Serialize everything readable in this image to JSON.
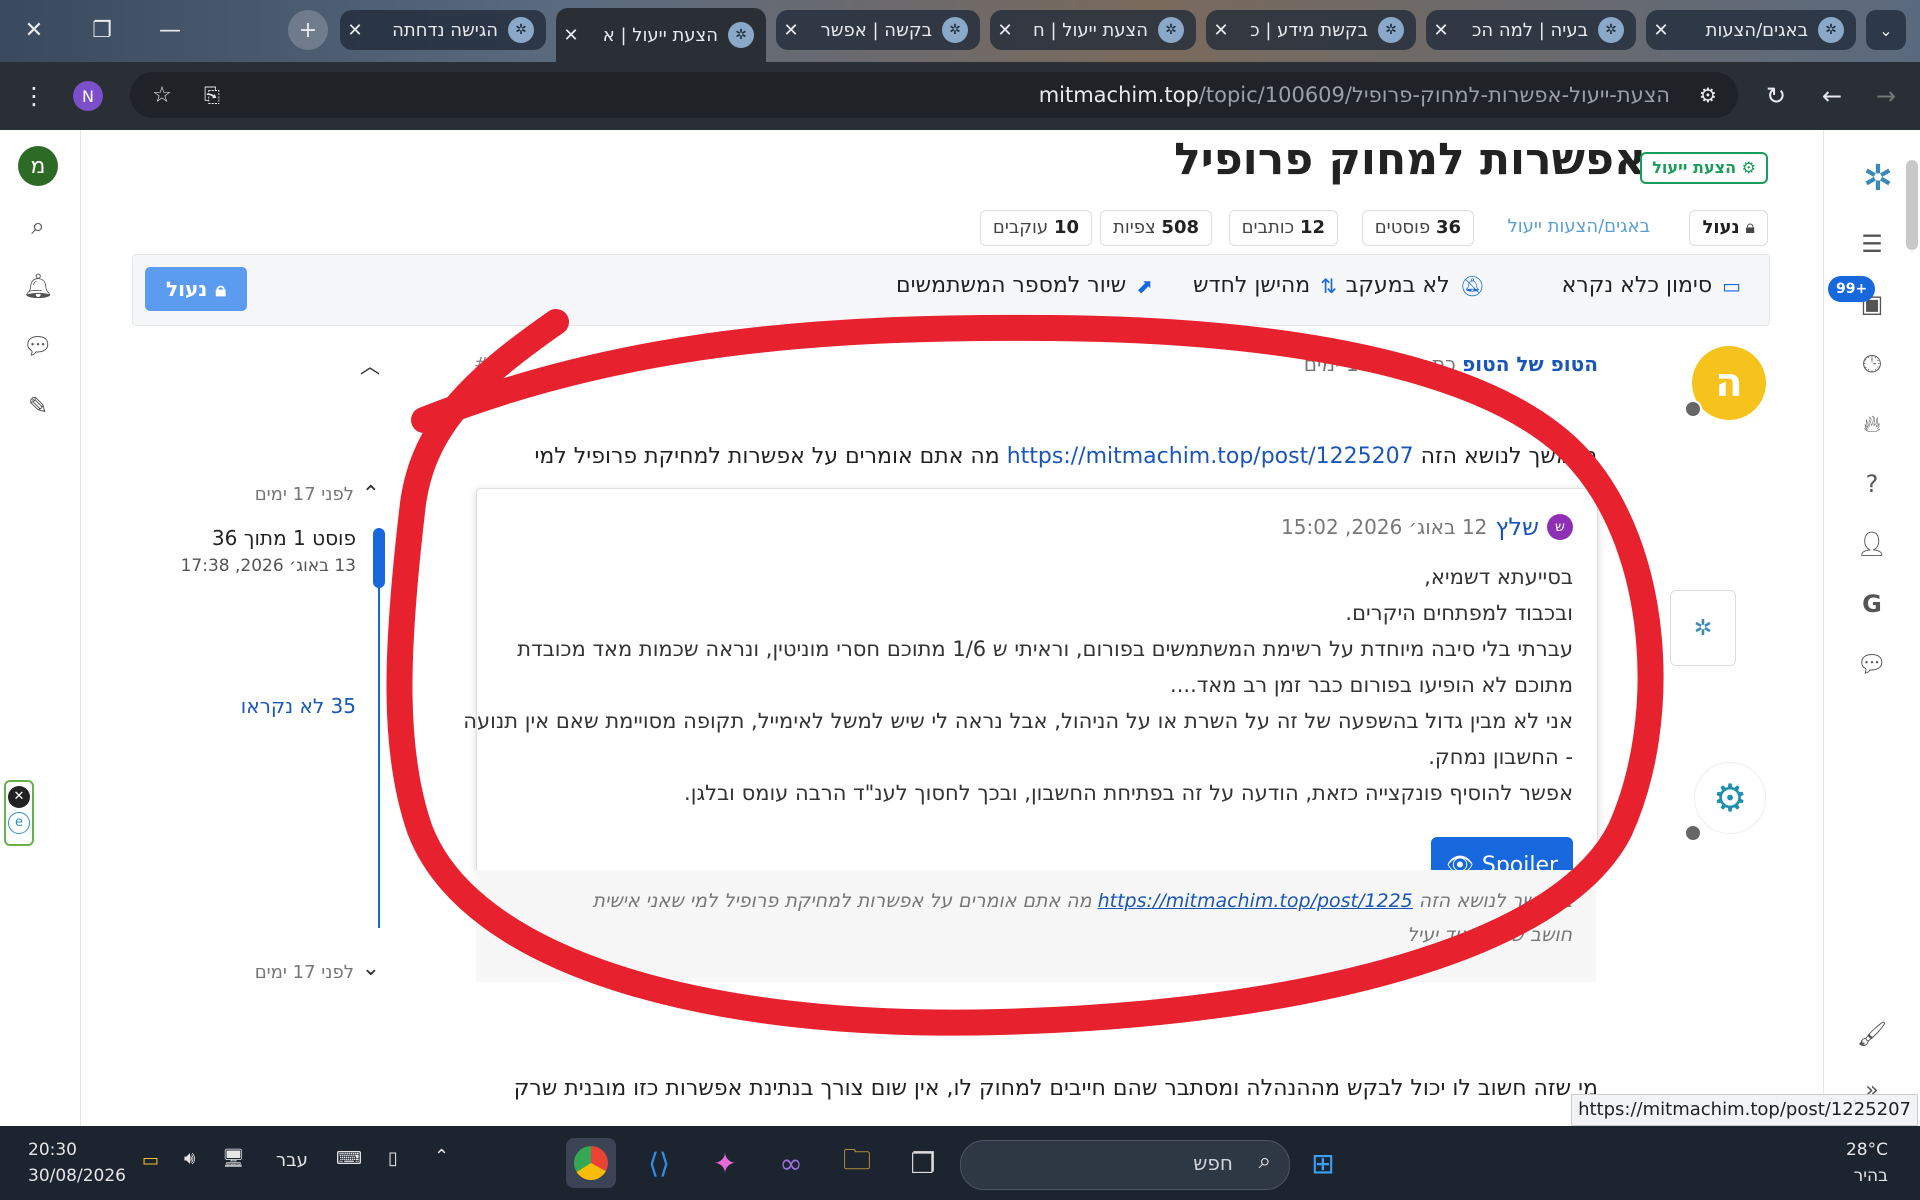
{
  "tabs": [
    {
      "label": "באגים/הצעות",
      "active": false
    },
    {
      "label": "בעיה | למה הכ",
      "active": false
    },
    {
      "label": "בקשת מידע | כ",
      "active": false
    },
    {
      "label": "הצעת ייעול | ח",
      "active": false
    },
    {
      "label": "בקשה | אפשר",
      "active": false
    },
    {
      "label": "הצעת ייעול | א",
      "active": true
    },
    {
      "label": "הגישה נדחתה",
      "active": false
    }
  ],
  "toolbar": {
    "url_domain": "mitmachim.top",
    "url_path": "/topic/100609/הצעת-ייעול-אפשרות-למחוק-פרופיל",
    "profile_initial": "N"
  },
  "topic": {
    "title": "אפשרות למחוק פרופיל",
    "tag": "הצעת ייעול",
    "locked_label": "נעול",
    "category": "באגים/הצעות ייעול",
    "posts_count": "36",
    "posts_label": "פוסטים",
    "writers_count": "12",
    "writers_label": "כותבים",
    "views_count": "508",
    "views_label": "צפיות",
    "followers_count": "10",
    "followers_label": "עוקבים"
  },
  "actions": {
    "mark_unread": "סימון כלא נקרא",
    "not_tracking": "לא במעקב",
    "oldest_first": "מהישן לחדש",
    "share": "שיור למספר המשתמשים",
    "locked_button": "נעול"
  },
  "timeline": {
    "top_time": "לפני 17 ימים",
    "position": "פוסט 1 מתוך 36",
    "date": "13 באוג׳ 2026, 17:38",
    "unread": "35 לא נקראו",
    "bottom_time": "לפני 17 ימים"
  },
  "post": {
    "author_initial": "ה",
    "author": "הטופ של הטופ",
    "wrote": "כתב לפני 17 ימים",
    "index": "#1",
    "text_before": "בהמשך לנושא הזה",
    "link": "https://mitmachim.top/post/1225207",
    "text_after": "מה אתם אומרים על אפשרות למחיקת פרופיל למי"
  },
  "quote": {
    "author_initial": "ש",
    "author": "שלץ",
    "date": "12 באוג׳ 2026, 15:02",
    "lines": [
      "בסייעתא דשמיא,",
      "ובכבוד למפתחים היקרים.",
      "עברתי בלי סיבה מיוחדת על רשימת המשתמשים בפורום, וראיתי ש 1/6 מתוכם חסרי מוניטין, ונראה שכמות מאד מכובדת",
      "מתוכם לא הופיעו בפורום כבר זמן רב מאד....",
      "אני לא מבין גדול בהשפעה של זה על השרת או על הניהול, אבל נראה לי שיש למשל לאימייל, תקופה מסויימת שאם אין תנועה",
      "- החשבון נמחק.",
      "אפשר להוסיף פונקצייה כזאת, הודעה על זה בפתיחת החשבון, ובכך לחסוך לענ\"ד הרבה עומס ובלגן."
    ],
    "spoiler": "Spoiler"
  },
  "quotebox": {
    "line1_a": "בהמשך לנושא הזה",
    "line1_link": "https://mitmachim.top/post/1225",
    "line1_b": "מה אתם אומרים על אפשרות למחיקת פרופיל למי שאני אישית",
    "line2": "חושב שזה מאוד יעיל"
  },
  "reply_preview": "מי שזה חשוב לו יכול לבקש מההנהלה ומסתבר שהם חייבים למחוק לו, אין שום צורך בנתינת אפשרות כזו מובנית שרק",
  "hover_url": "https://mitmachim.top/post/1225207",
  "left_rail": {
    "user_initial": "מ"
  },
  "right_rail": {
    "badge": "99+"
  },
  "taskbar": {
    "time": "20:30",
    "date": "30/08/2026",
    "lang": "עבר",
    "search_placeholder": "חפש",
    "temp": "28°C",
    "weather": "בהיר"
  },
  "colors": {
    "accent": "#1668dc",
    "annotation": "#e8212e",
    "badge_green": "#1a9c5a"
  }
}
